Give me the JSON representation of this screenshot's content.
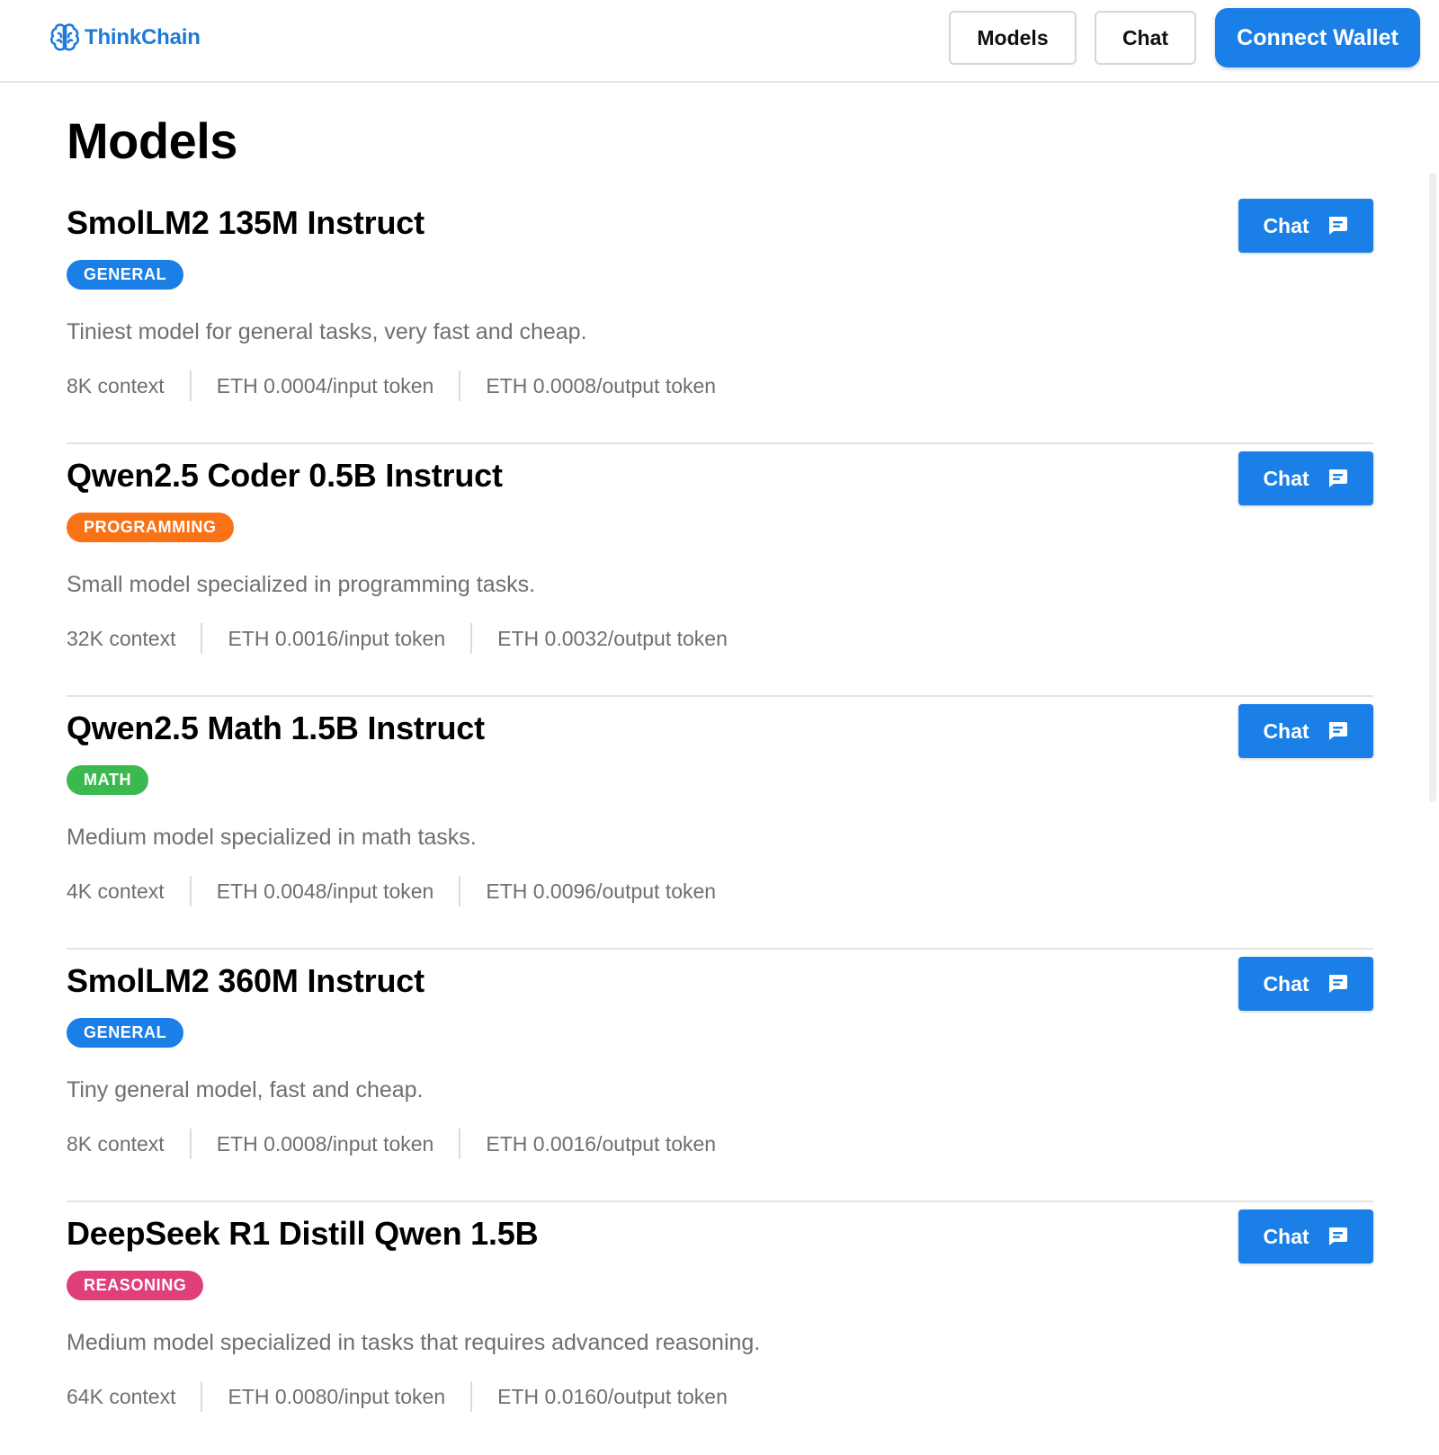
{
  "header": {
    "brand": "ThinkChain",
    "nav": {
      "models_label": "Models",
      "chat_label": "Chat"
    },
    "connect_wallet_label": "Connect Wallet"
  },
  "page": {
    "title": "Models"
  },
  "colors": {
    "accent": "#1a7fe6",
    "brand": "#1f7ad6",
    "badge_general": "#1a7fe6",
    "badge_programming": "#f97316",
    "badge_math": "#3cb94e",
    "badge_reasoning": "#e0407a"
  },
  "models": [
    {
      "name": "SmolLM2 135M Instruct",
      "category": "GENERAL",
      "category_color": "#1a7fe6",
      "description": "Tiniest model for general tasks, very fast and cheap.",
      "context": "8K context",
      "input_price": "ETH 0.0004/input token",
      "output_price": "ETH 0.0008/output token",
      "chat_label": "Chat",
      "chat_icon": "chat-bubble-icon"
    },
    {
      "name": "Qwen2.5 Coder 0.5B Instruct",
      "category": "PROGRAMMING",
      "category_color": "#f97316",
      "description": "Small model specialized in programming tasks.",
      "context": "32K context",
      "input_price": "ETH 0.0016/input token",
      "output_price": "ETH 0.0032/output token",
      "chat_label": "Chat",
      "chat_icon": "chat-bubble-icon"
    },
    {
      "name": "Qwen2.5 Math 1.5B Instruct",
      "category": "MATH",
      "category_color": "#3cb94e",
      "description": "Medium model specialized in math tasks.",
      "context": "4K context",
      "input_price": "ETH 0.0048/input token",
      "output_price": "ETH 0.0096/output token",
      "chat_label": "Chat",
      "chat_icon": "chat-bubble-icon"
    },
    {
      "name": "SmolLM2 360M Instruct",
      "category": "GENERAL",
      "category_color": "#1a7fe6",
      "description": "Tiny general model, fast and cheap.",
      "context": "8K context",
      "input_price": "ETH 0.0008/input token",
      "output_price": "ETH 0.0016/output token",
      "chat_label": "Chat",
      "chat_icon": "chat-bubble-icon"
    },
    {
      "name": "DeepSeek R1 Distill Qwen 1.5B",
      "category": "REASONING",
      "category_color": "#e0407a",
      "description": "Medium model specialized in tasks that requires advanced reasoning.",
      "context": "64K context",
      "input_price": "ETH 0.0080/input token",
      "output_price": "ETH 0.0160/output token",
      "chat_label": "Chat",
      "chat_icon": "chat-bubble-icon"
    }
  ]
}
